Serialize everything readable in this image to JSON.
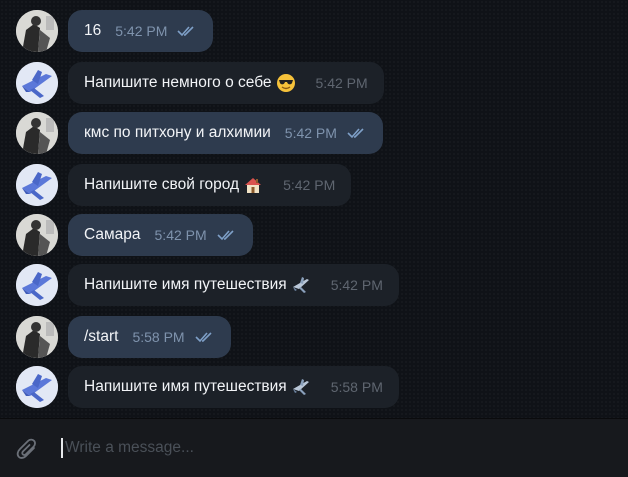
{
  "messages": [
    {
      "sender": "user",
      "text": "16",
      "time": "5:42 PM",
      "read": true
    },
    {
      "sender": "bot",
      "text": "Напишите немного о себе",
      "emoji": "sunglasses-emoji",
      "time": "5:42 PM"
    },
    {
      "sender": "user",
      "text": "кмс по питхону и алхимии",
      "time": "5:42 PM",
      "read": true
    },
    {
      "sender": "bot",
      "text": "Напишите свой город",
      "emoji": "house-emoji",
      "time": "5:42 PM"
    },
    {
      "sender": "user",
      "text": "Самара",
      "time": "5:42 PM",
      "read": true
    },
    {
      "sender": "bot",
      "text": "Напишите имя путешествия",
      "emoji": "airplane-emoji",
      "time": "5:42 PM"
    },
    {
      "sender": "user",
      "text": "/start",
      "time": "5:58 PM",
      "read": true
    },
    {
      "sender": "bot",
      "text": "Напишите имя путешествия",
      "emoji": "airplane-emoji",
      "time": "5:58 PM"
    }
  ],
  "composer": {
    "placeholder": "Write a message...",
    "value": "",
    "attach_icon": "paperclip-icon"
  },
  "colors": {
    "outgoing_bubble": "#2e3b4e",
    "incoming_bubble": "#1c2128",
    "read_checks": "#7fa0c8",
    "background": "#0f1217"
  }
}
